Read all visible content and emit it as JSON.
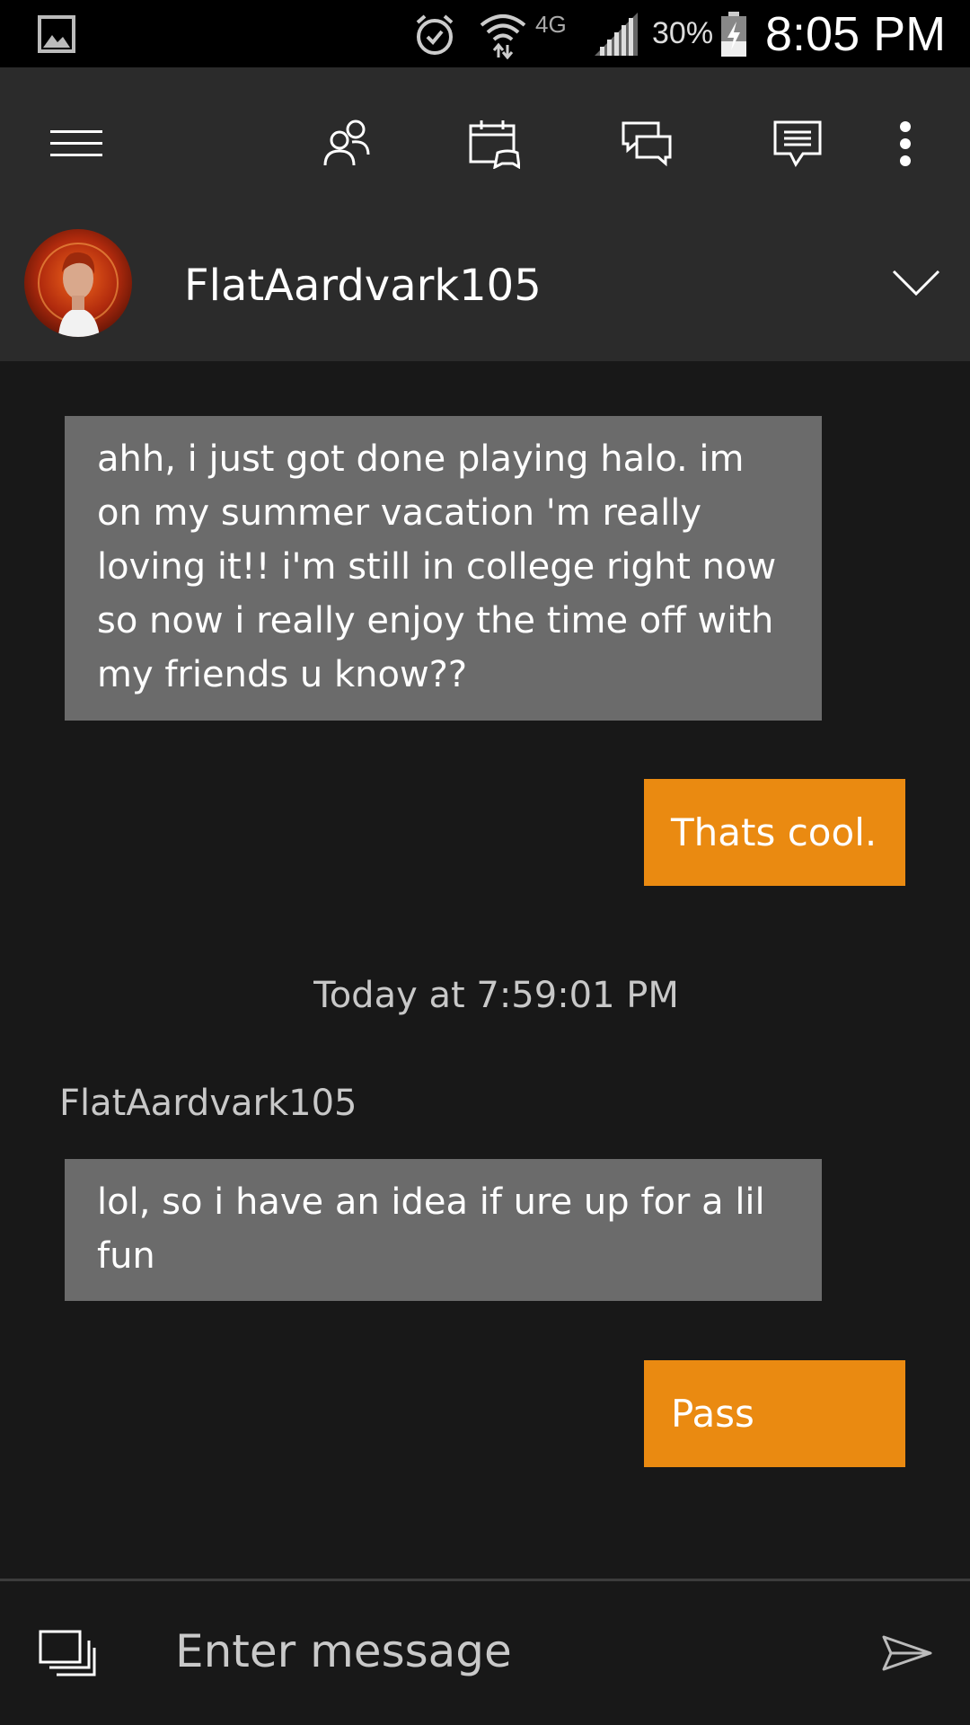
{
  "status_bar": {
    "network": "4G",
    "battery": "30%",
    "time": "8:05 PM"
  },
  "toolbar": {
    "icons": [
      "menu-icon",
      "friends-icon",
      "events-icon",
      "conversations-icon",
      "messages-icon",
      "more-icon"
    ]
  },
  "conversation": {
    "name": "FlatAardvark105",
    "avatar_colors": {
      "bg": "#b02a0d",
      "glow": "#f0641c"
    }
  },
  "messages": [
    {
      "direction": "in",
      "text": "ahh, i just got done playing halo. im on my summer vacation 'm really loving it!! i'm still in college right now so now i really enjoy the time off with my friends u know??"
    },
    {
      "direction": "out",
      "text": "Thats cool."
    },
    {
      "type": "timestamp",
      "text": "Today at 7:59:01 PM"
    },
    {
      "type": "sender",
      "text": "FlatAardvark105"
    },
    {
      "direction": "in",
      "text": "lol, so i have an idea if ure up for a lil fun"
    },
    {
      "direction": "out",
      "text": "Pass"
    }
  ],
  "compose": {
    "placeholder": "Enter message"
  },
  "colors": {
    "incoming_bubble": "#6b6b6b",
    "outgoing_bubble": "#ea8a11",
    "background": "#181818",
    "bar": "#2b2b2b"
  }
}
